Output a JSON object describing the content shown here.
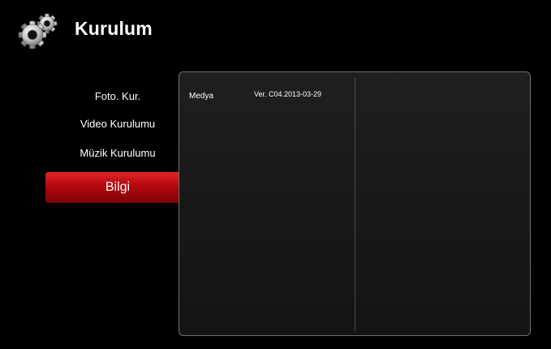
{
  "header": {
    "icon": "gears-icon",
    "title": "Kurulum"
  },
  "menu": {
    "items": [
      {
        "label": "Foto. Kur.",
        "selected": false
      },
      {
        "label": "Video Kurulumu",
        "selected": false
      },
      {
        "label": "Müzik Kurulumu",
        "selected": false
      },
      {
        "label": "Bilgi",
        "selected": true
      }
    ]
  },
  "info": {
    "label": "Medya",
    "value": "Ver. C04.2013-03-29"
  },
  "colors": {
    "background": "#000000",
    "selected_item": "#b3080c",
    "panel_border": "#6f6f6f",
    "text": "#ffffff"
  }
}
